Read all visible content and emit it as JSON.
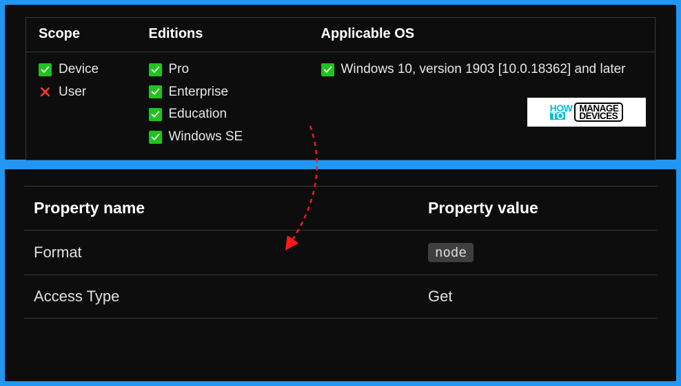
{
  "top": {
    "headers": {
      "scope": "Scope",
      "editions": "Editions",
      "os": "Applicable OS"
    },
    "scope": [
      {
        "status": "yes",
        "label": "Device"
      },
      {
        "status": "no",
        "label": "User"
      }
    ],
    "editions": [
      {
        "status": "yes",
        "label": "Pro"
      },
      {
        "status": "yes",
        "label": "Enterprise"
      },
      {
        "status": "yes",
        "label": "Education"
      },
      {
        "status": "yes",
        "label": "Windows SE"
      }
    ],
    "os": [
      {
        "status": "yes",
        "label": "Windows 10, version 1903 [10.0.18362] and later"
      }
    ]
  },
  "bottom": {
    "headers": {
      "name": "Property name",
      "value": "Property value"
    },
    "rows": [
      {
        "name": "Format",
        "value": "node",
        "badge": true
      },
      {
        "name": "Access Type",
        "value": "Get",
        "badge": false
      }
    ]
  },
  "logo": {
    "how": "HOW",
    "to": "TO",
    "manage": "MANAGE",
    "devices": "DEVICES"
  }
}
